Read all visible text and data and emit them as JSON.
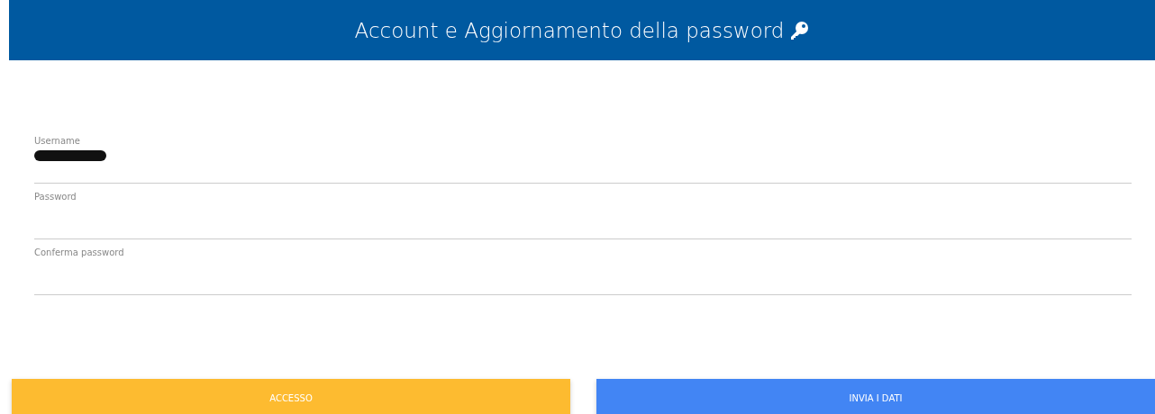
{
  "header": {
    "title": "Account e Aggiornamento della password"
  },
  "fields": [
    {
      "label": "Username",
      "redacted": true
    },
    {
      "label": "Password",
      "redacted": false
    },
    {
      "label": "Conferma password",
      "redacted": false
    }
  ],
  "buttons": [
    {
      "label": "ACCESSO",
      "kind": "warning"
    },
    {
      "label": "INVIA I DATI",
      "kind": "primary"
    }
  ]
}
